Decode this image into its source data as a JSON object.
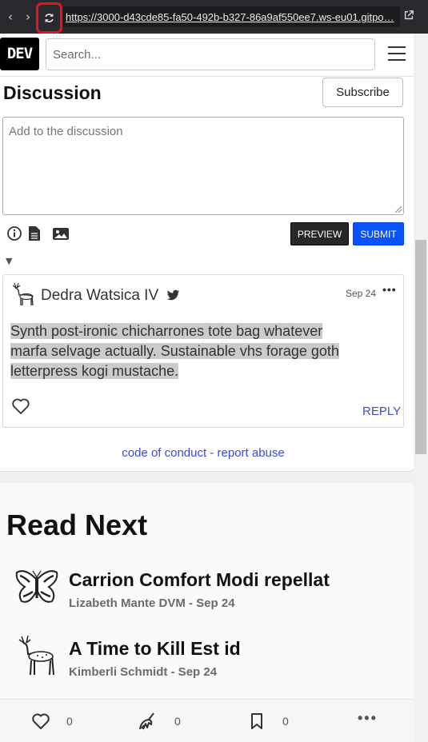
{
  "browser": {
    "url": "https://3000-d43cde85-fa50-492b-b327-86a9af550ee7.ws-eu01.gitpo…"
  },
  "header": {
    "logo": "DEV",
    "search_placeholder": "Search..."
  },
  "discussion": {
    "title": "Discussion",
    "subscribe_label": "Subscribe",
    "textarea_placeholder": "Add to the discussion",
    "preview_label": "PREVIEW",
    "submit_label": "SUBMIT"
  },
  "comment": {
    "author": "Dedra Watsica IV",
    "date": "Sep 24",
    "menu": "•••",
    "body": "Synth post-ironic chicharrones tote bag whatever marfa selvage actually. Sustainable vhs forage goth letterpress kogi mustache.",
    "reply_label": "REPLY"
  },
  "footer": {
    "code_of_conduct": "code of conduct",
    "separator": "-",
    "report_abuse": "report abuse"
  },
  "read_next": {
    "title": "Read Next",
    "items": [
      {
        "title": "Carrion Comfort Modi repellat",
        "meta": "Lizabeth Mante DVM - Sep 24",
        "image": "butterfly-image"
      },
      {
        "title": "A Time to Kill Est id",
        "meta": "Kimberli Schmidt - Sep 24",
        "image": "deer-image"
      }
    ]
  },
  "bottom_bar": {
    "likes": "0",
    "unicorns": "0",
    "bookmarks": "0",
    "more": "•••"
  },
  "colors": {
    "primary_blue": "#0a52ff",
    "link_blue": "#3b49df",
    "highlight": "#cbcbcb",
    "reload_outline": "#e8141b"
  }
}
